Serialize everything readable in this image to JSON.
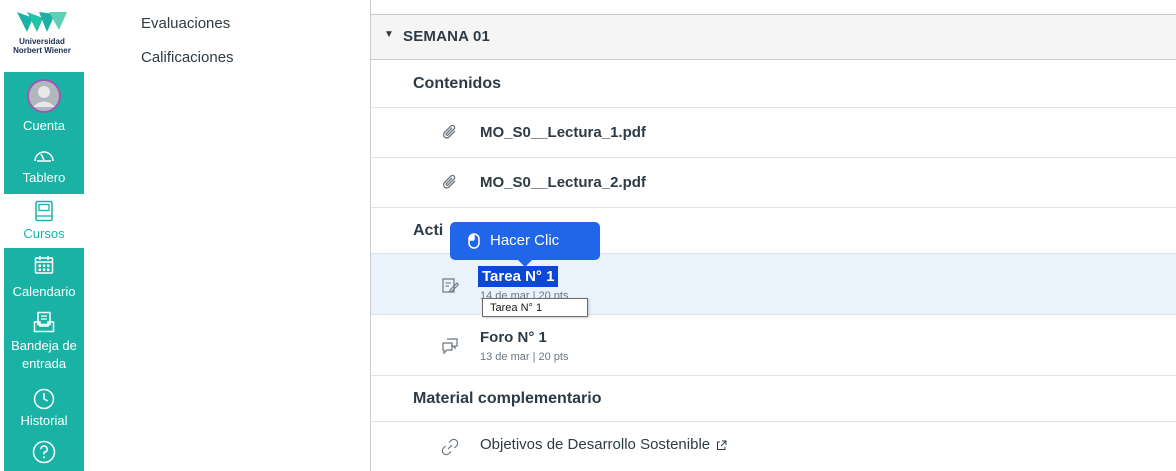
{
  "logo": {
    "line1": "Universidad",
    "line2": "Norbert Wiener"
  },
  "global_nav": {
    "account": "Cuenta",
    "dashboard": "Tablero",
    "courses": "Cursos",
    "calendar": "Calendario",
    "inbox_line1": "Bandeja de",
    "inbox_line2": "entrada",
    "history": "Historial"
  },
  "course_nav": {
    "items": [
      "Evaluaciones",
      "Calificaciones"
    ]
  },
  "module": {
    "title": "SEMANA 01",
    "sections": {
      "contents": "Contenidos",
      "activities": "Acti",
      "supplementary": "Material complementario"
    },
    "items": {
      "reading1": "MO_S0__Lectura_1.pdf",
      "reading2": "MO_S0__Lectura_2.pdf",
      "task_title": "Tarea N° 1",
      "task_meta": "14 de mar | 20 pts",
      "forum_title": "Foro N° 1",
      "forum_meta": "13 de mar  |  20 pts",
      "link_title": "Objetivos de Desarrollo Sostenible"
    }
  },
  "overlay": {
    "click_label": "Hacer Clic",
    "hover_tooltip": "Tarea N° 1"
  },
  "colors": {
    "nav_teal": "#19b2a4",
    "click_blue": "#2166e8",
    "selection_blue": "#0b47d8"
  }
}
